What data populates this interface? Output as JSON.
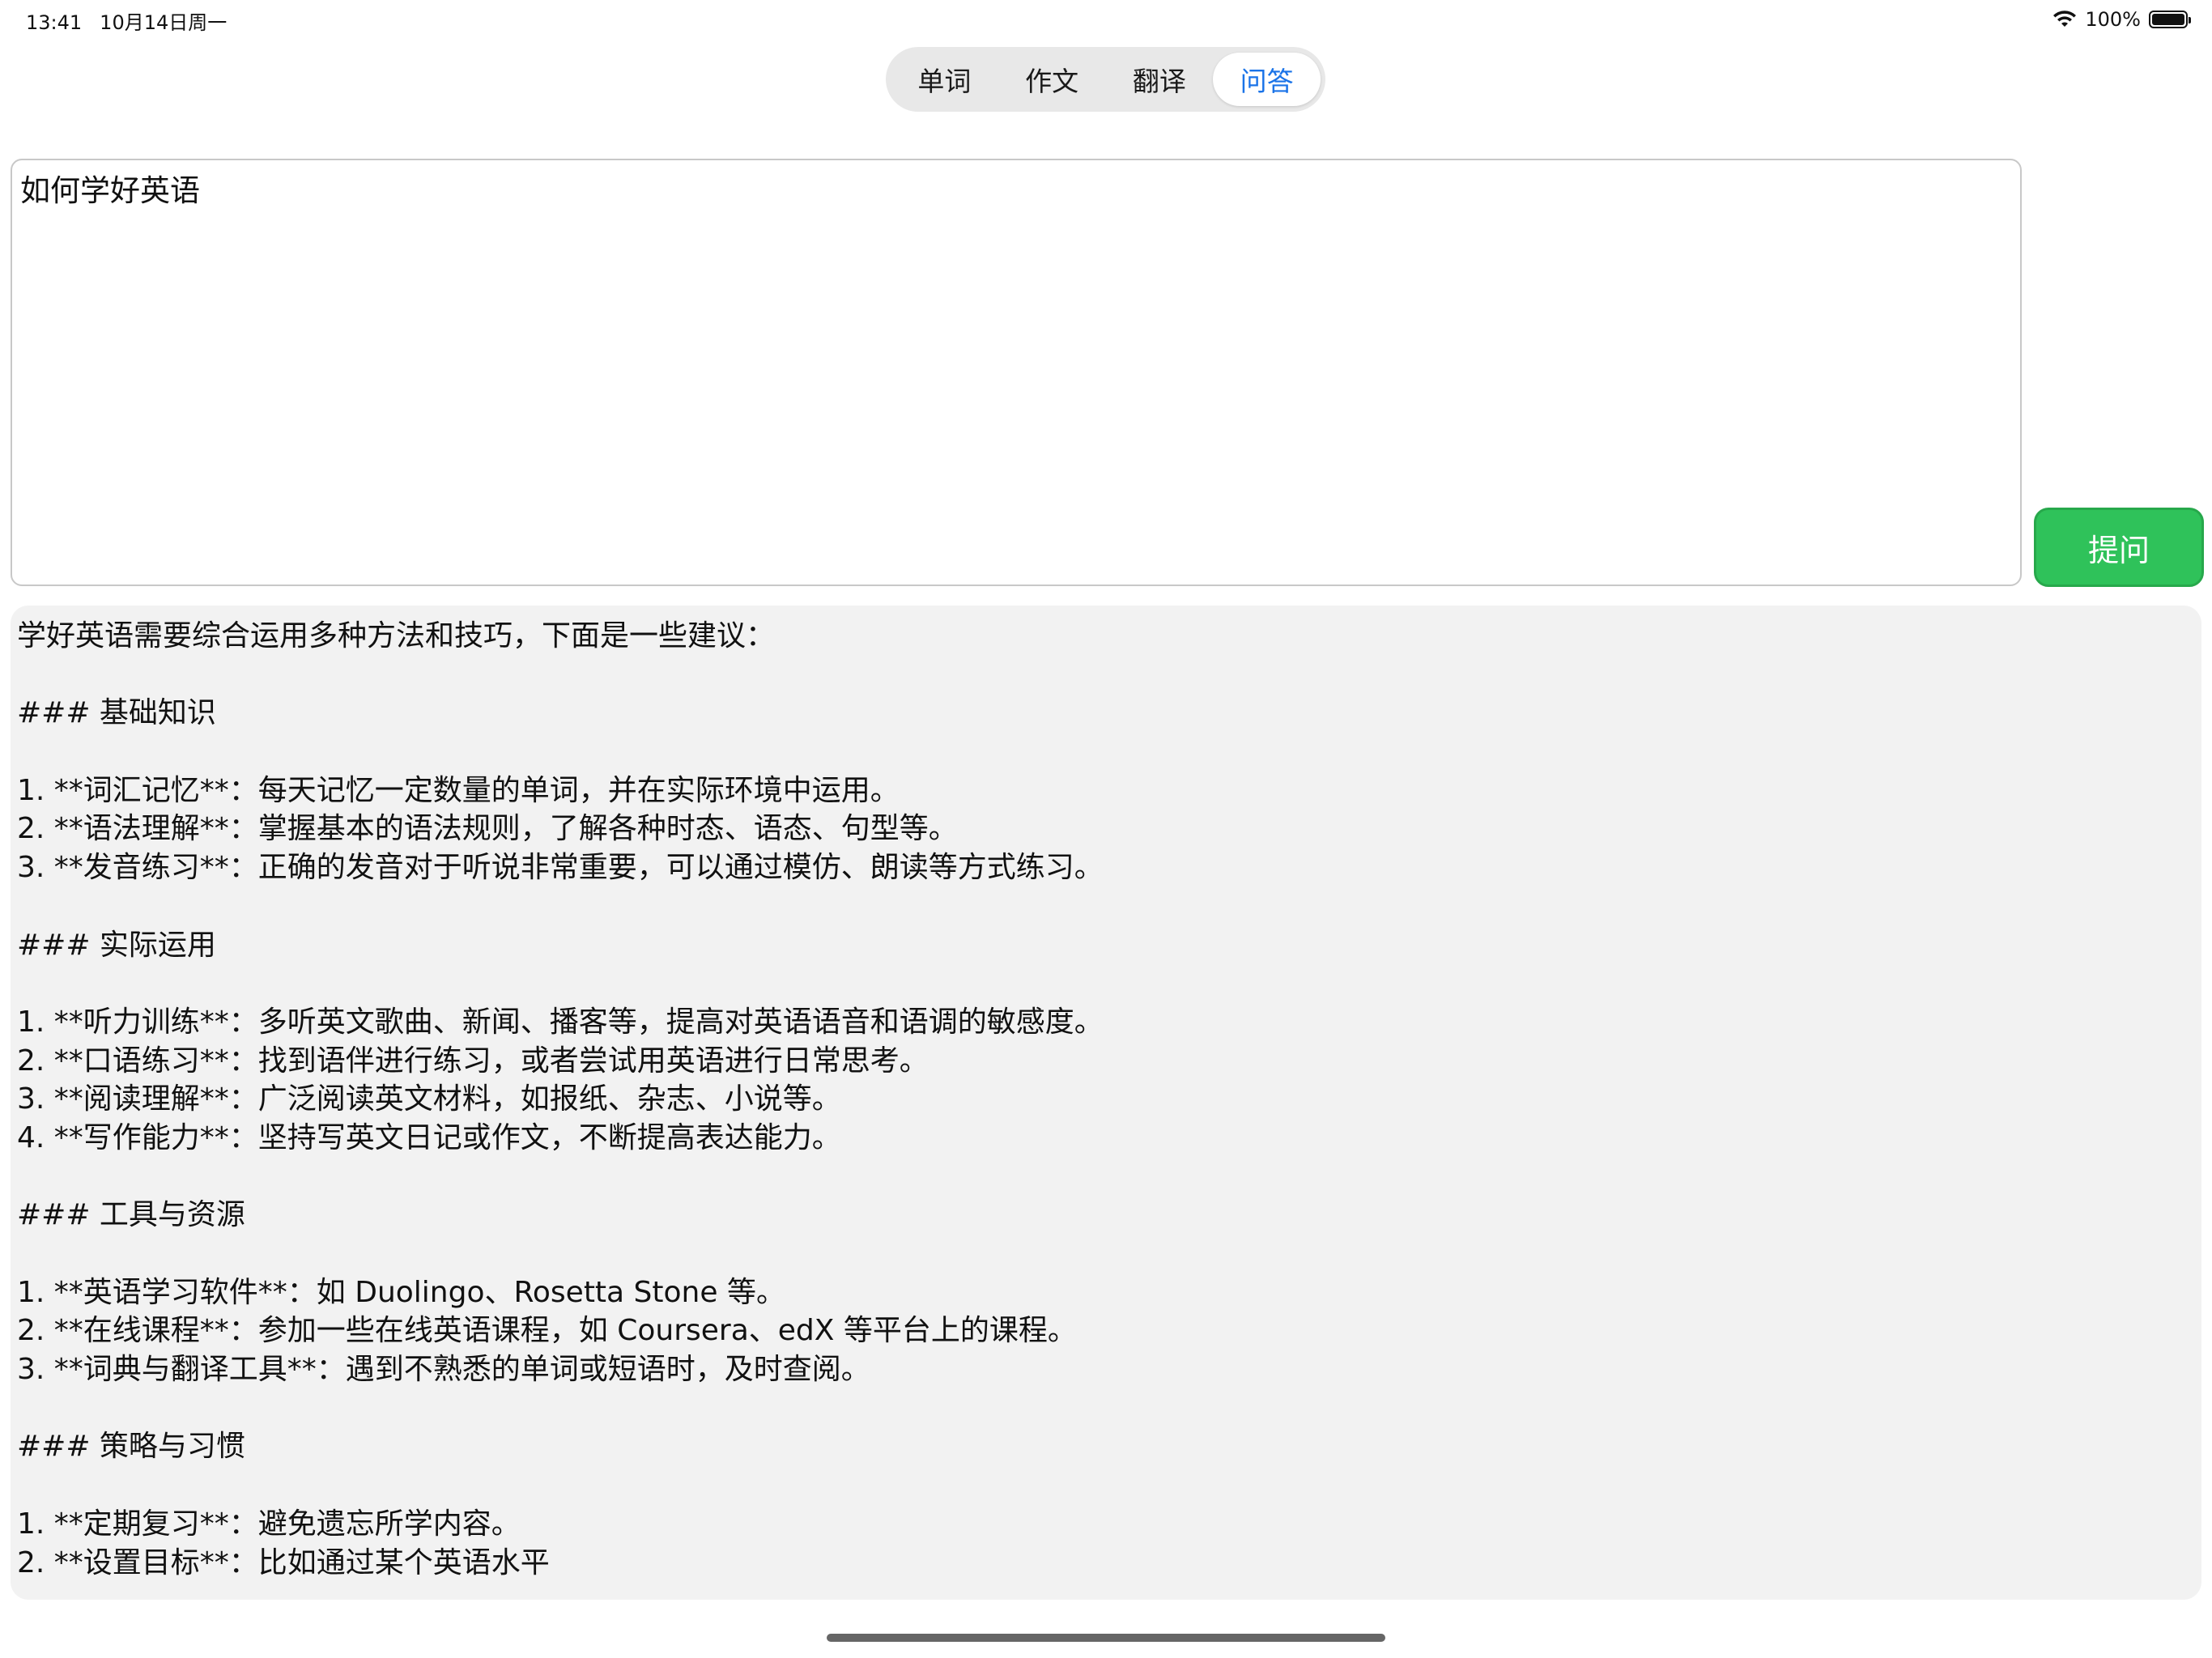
{
  "status_bar": {
    "time": "13:41",
    "date": "10月14日周一",
    "battery_percent": "100%",
    "battery_level": 1.0,
    "icons": [
      "wifi-icon",
      "battery-icon"
    ]
  },
  "tabs": [
    {
      "label": "单词",
      "selected": false
    },
    {
      "label": "作文",
      "selected": false
    },
    {
      "label": "翻译",
      "selected": false
    },
    {
      "label": "问答",
      "selected": true
    }
  ],
  "question": {
    "value": "如何学好英语"
  },
  "ask_button": {
    "label": "提问",
    "color": "#2fc25a"
  },
  "answer": {
    "lines": [
      "学好英语需要综合运用多种方法和技巧，下面是一些建议：",
      "",
      "### 基础知识",
      "",
      "1. **词汇记忆**：每天记忆一定数量的单词，并在实际环境中运用。",
      "2. **语法理解**：掌握基本的语法规则，了解各种时态、语态、句型等。",
      "3. **发音练习**：正确的发音对于听说非常重要，可以通过模仿、朗读等方式练习。",
      "",
      "### 实际运用",
      "",
      "1. **听力训练**：多听英文歌曲、新闻、播客等，提高对英语语音和语调的敏感度。",
      "2. **口语练习**：找到语伴进行练习，或者尝试用英语进行日常思考。",
      "3. **阅读理解**：广泛阅读英文材料，如报纸、杂志、小说等。",
      "4. **写作能力**：坚持写英文日记或作文，不断提高表达能力。",
      "",
      "### 工具与资源",
      "",
      "1. **英语学习软件**：如 Duolingo、Rosetta Stone 等。",
      "2. **在线课程**：参加一些在线英语课程，如 Coursera、edX 等平台上的课程。",
      "3. **词典与翻译工具**：遇到不熟悉的单词或短语时，及时查阅。",
      "",
      "### 策略与习惯",
      "",
      "1. **定期复习**：避免遗忘所学内容。",
      "2. **设置目标**：比如通过某个英语水平"
    ]
  }
}
